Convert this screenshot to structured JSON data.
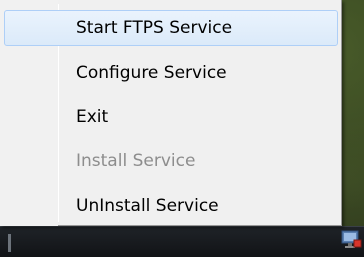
{
  "context_menu": {
    "items": [
      {
        "label": "Start FTPS Service",
        "state": "highlighted"
      },
      {
        "label": "Configure Service",
        "state": "enabled"
      },
      {
        "label": "Exit",
        "state": "enabled"
      },
      {
        "label": "Install Service",
        "state": "disabled"
      },
      {
        "label": "UnInstall Service",
        "state": "enabled"
      }
    ]
  },
  "taskbar": {
    "tray_icon": "ftps-service-tray-icon"
  },
  "colors": {
    "menu_background": "#f0f0f0",
    "highlight_background": "#dbeaf9",
    "highlight_border": "#aecff7",
    "disabled_text": "#8d8d8d",
    "taskbar": "#111316"
  }
}
